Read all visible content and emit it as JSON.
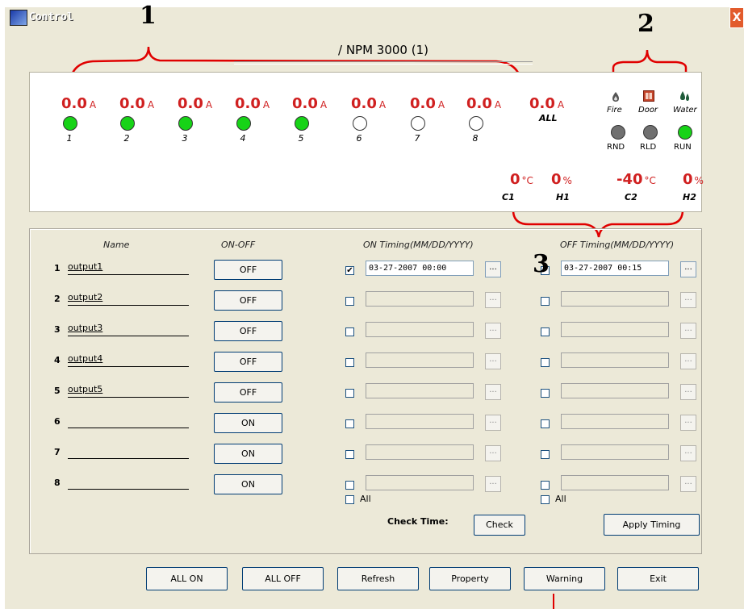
{
  "window": {
    "title": "Control",
    "close_symbol": "X"
  },
  "annotations": [
    "1",
    "2",
    "3"
  ],
  "device_title": "/ NPM 3000 (1)",
  "currents": [
    {
      "value": "0.0",
      "unit": "A",
      "label": "1",
      "led": "green"
    },
    {
      "value": "0.0",
      "unit": "A",
      "label": "2",
      "led": "green"
    },
    {
      "value": "0.0",
      "unit": "A",
      "label": "3",
      "led": "green"
    },
    {
      "value": "0.0",
      "unit": "A",
      "label": "4",
      "led": "green"
    },
    {
      "value": "0.0",
      "unit": "A",
      "label": "5",
      "led": "green"
    },
    {
      "value": "0.0",
      "unit": "A",
      "label": "6",
      "led": "off"
    },
    {
      "value": "0.0",
      "unit": "A",
      "label": "7",
      "led": "off"
    },
    {
      "value": "0.0",
      "unit": "A",
      "label": "8",
      "led": "off"
    }
  ],
  "total": {
    "value": "0.0",
    "unit": "A",
    "label": "ALL"
  },
  "sensors": [
    {
      "name": "Fire",
      "icon": "fire-icon"
    },
    {
      "name": "Door",
      "icon": "door-icon"
    },
    {
      "name": "Water",
      "icon": "water-icon"
    }
  ],
  "indicators": [
    {
      "name": "RND",
      "led": "gray"
    },
    {
      "name": "RLD",
      "led": "gray"
    },
    {
      "name": "RUN",
      "led": "green"
    }
  ],
  "environment": [
    {
      "value": "0",
      "unit": "°C",
      "label": "C1"
    },
    {
      "value": "0",
      "unit": "%",
      "label": "H1"
    },
    {
      "value": "-40",
      "unit": "°C",
      "label": "C2"
    },
    {
      "value": "0",
      "unit": "%",
      "label": "H2"
    }
  ],
  "table": {
    "headers": {
      "name": "Name",
      "onoff": "ON-OFF",
      "on_timing": "ON Timing(MM/DD/YYYY)",
      "off_timing": "OFF Timing(MM/DD/YYYY)"
    },
    "rows": [
      {
        "num": "1",
        "name": "output1",
        "button": "OFF",
        "on_checked": true,
        "on_time": "03-27-2007 00:00",
        "off_checked": false,
        "off_time": "03-27-2007 00:15"
      },
      {
        "num": "2",
        "name": "output2",
        "button": "OFF",
        "on_checked": false,
        "on_time": "",
        "off_checked": false,
        "off_time": ""
      },
      {
        "num": "3",
        "name": "output3",
        "button": "OFF",
        "on_checked": false,
        "on_time": "",
        "off_checked": false,
        "off_time": ""
      },
      {
        "num": "4",
        "name": "output4",
        "button": "OFF",
        "on_checked": false,
        "on_time": "",
        "off_checked": false,
        "off_time": ""
      },
      {
        "num": "5",
        "name": "output5",
        "button": "OFF",
        "on_checked": false,
        "on_time": "",
        "off_checked": false,
        "off_time": ""
      },
      {
        "num": "6",
        "name": "",
        "button": "ON",
        "on_checked": false,
        "on_time": "",
        "off_checked": false,
        "off_time": ""
      },
      {
        "num": "7",
        "name": "",
        "button": "ON",
        "on_checked": false,
        "on_time": "",
        "off_checked": false,
        "off_time": ""
      },
      {
        "num": "8",
        "name": "",
        "button": "ON",
        "on_checked": false,
        "on_time": "",
        "off_checked": false,
        "off_time": ""
      }
    ],
    "ellipsis": "...",
    "all_label": "All",
    "check_time_label": "Check Time:",
    "check_button": "Check",
    "apply_button": "Apply Timing"
  },
  "footer_buttons": [
    "ALL ON",
    "ALL OFF",
    "Refresh",
    "Property",
    "Warning",
    "Exit"
  ],
  "colors": {
    "accent_red": "#d02020",
    "callout_red": "#e00000",
    "led_green": "#17d317",
    "window_bg": "#ece9d8"
  }
}
